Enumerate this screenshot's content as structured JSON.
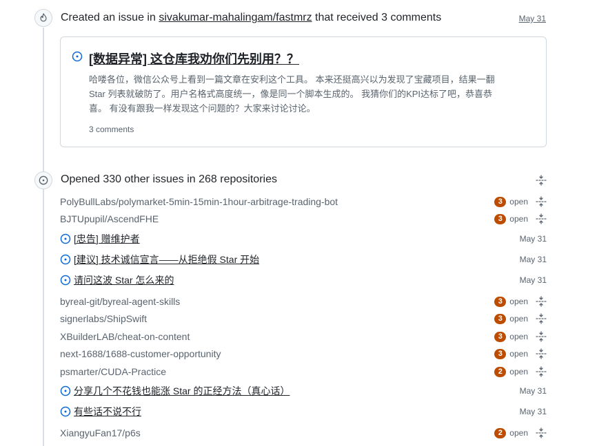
{
  "event1": {
    "prefix": "Created an issue in",
    "repo": "sivakumar-mahalingam/fastmrz",
    "suffix": "that received 3 comments",
    "date": "May 31",
    "issue": {
      "title": "[数据异常] 这仓库我劝你们先别用？？",
      "body_line1": "哈喽各位，微信公众号上看到一篇文章在安利这个工具。 本来还挺高兴以为发现了宝藏项目，结果一翻",
      "body_line2": "Star 列表就破防了。用户名格式高度统一，像是同一个脚本生成的。 我猜你们的KPI达标了吧，恭喜恭",
      "body_line3": "喜。 有没有跟我一样发现这个问题的？大家来讨论讨论。",
      "comments": "3 comments"
    }
  },
  "event2": {
    "heading": "Opened 330 other issues in 268 repositories"
  },
  "rows": [
    {
      "repo": "PolyBullLabs/polymarket-5min-15min-1hour-arbitrage-trading-bot",
      "count": "3",
      "status": "open"
    },
    {
      "repo": "BJTUpupil/AscendFHE",
      "count": "3",
      "status": "open"
    },
    {
      "issue": "[忠告] 赠维护者",
      "date": "May 31"
    },
    {
      "issue": "[建议] 技术诚信宣言——从拒绝假 Star 开始",
      "date": "May 31"
    },
    {
      "issue": "请问这波 Star 怎么来的",
      "date": "May 31"
    },
    {
      "repo": "byreal-git/byreal-agent-skills",
      "count": "3",
      "status": "open"
    },
    {
      "repo": "signerlabs/ShipSwift",
      "count": "3",
      "status": "open"
    },
    {
      "repo": "XBuilderLAB/cheat-on-content",
      "count": "3",
      "status": "open"
    },
    {
      "repo": "next-1688/1688-customer-opportunity",
      "count": "3",
      "status": "open"
    },
    {
      "repo": "psmarter/CUDA-Practice",
      "count": "2",
      "status": "open"
    },
    {
      "issue": "分享几个不花钱也能涨 Star 的正经方法（真心话）",
      "date": "May 31"
    },
    {
      "issue": "有些话不说不行",
      "date": "May 31"
    },
    {
      "repo": "XiangyuFan17/p6s",
      "count": "2",
      "status": "open"
    }
  ],
  "colors": {
    "open_issue_icon": "#0969da",
    "count_badge": "#bc4c00",
    "muted": "#59636e"
  }
}
